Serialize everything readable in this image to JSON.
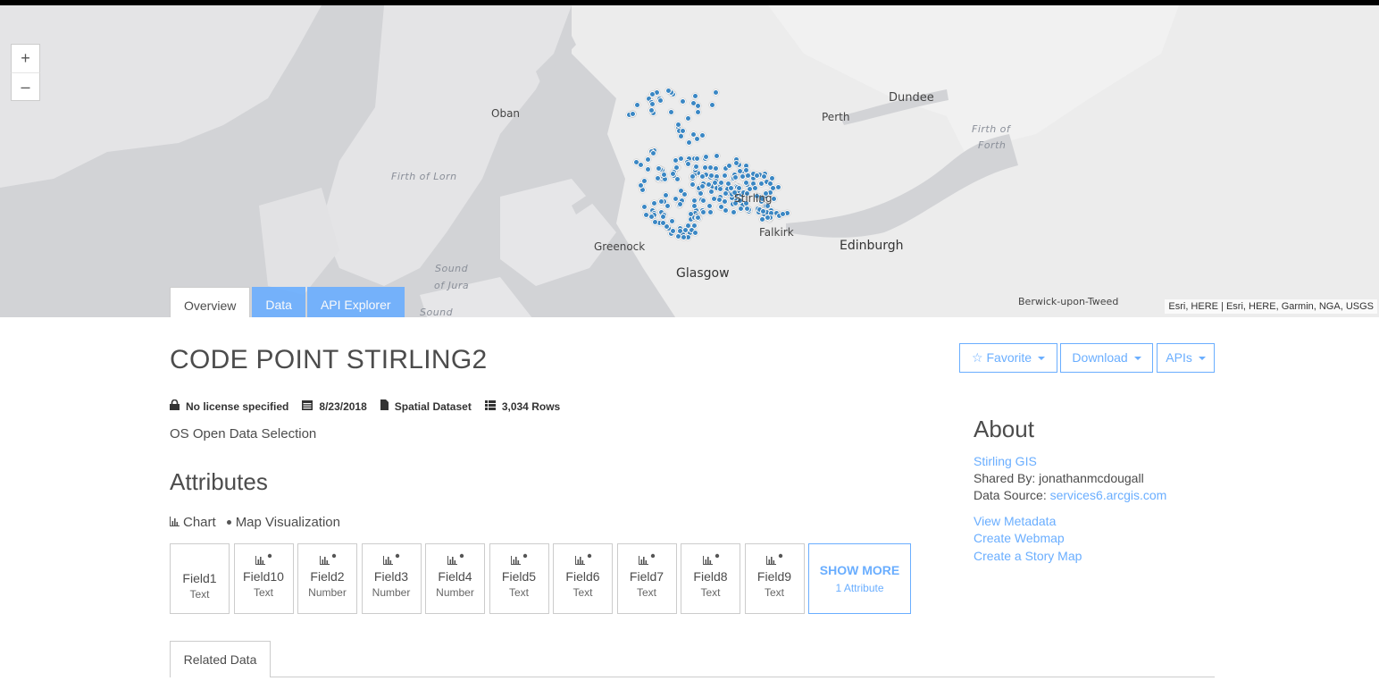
{
  "map": {
    "labels": {
      "dundee": "Dundee",
      "oban": "Oban",
      "perth": "Perth",
      "firth_of": "Firth of",
      "forth": "Forth",
      "firth_of_lorn": "Firth of Lorn",
      "stirling": "Stirling",
      "greenock": "Greenock",
      "falkirk": "Falkirk",
      "edinburgh": "Edinburgh",
      "glasgow": "Glasgow",
      "sound": "Sound",
      "of_jura": "of Jura",
      "sound2": "Sound",
      "berwick": "Berwick-upon-Tweed"
    },
    "attribution": "Esri, HERE | Esri, HERE, Garmin, NGA, USGS",
    "zoom_in": "+",
    "zoom_out": "–",
    "point_color": "#3a87c4"
  },
  "tabs": {
    "overview": "Overview",
    "data": "Data",
    "api_explorer": "API Explorer"
  },
  "dataset": {
    "title": "CODE POINT STIRLING2",
    "license": "No license specified",
    "date": "8/23/2018",
    "type": "Spatial Dataset",
    "rows": "3,034 Rows",
    "description": "OS Open Data Selection"
  },
  "attributes": {
    "heading": "Attributes",
    "legend_chart": "Chart",
    "legend_map": "Map Visualization",
    "fields": [
      {
        "name": "Field1",
        "type": "Text",
        "icons": false
      },
      {
        "name": "Field10",
        "type": "Text",
        "icons": true
      },
      {
        "name": "Field2",
        "type": "Number",
        "icons": true
      },
      {
        "name": "Field3",
        "type": "Number",
        "icons": true
      },
      {
        "name": "Field4",
        "type": "Number",
        "icons": true
      },
      {
        "name": "Field5",
        "type": "Text",
        "icons": true
      },
      {
        "name": "Field6",
        "type": "Text",
        "icons": true
      },
      {
        "name": "Field7",
        "type": "Text",
        "icons": true
      },
      {
        "name": "Field8",
        "type": "Text",
        "icons": true
      },
      {
        "name": "Field9",
        "type": "Text",
        "icons": true
      }
    ],
    "show_more": "SHOW MORE",
    "show_more_sub": "1 Attribute"
  },
  "related": {
    "tab": "Related Data"
  },
  "buttons": {
    "favorite": "Favorite",
    "download": "Download",
    "apis": "APIs"
  },
  "about": {
    "heading": "About",
    "org": "Stirling GIS",
    "shared_by_label": "Shared By: jonathanmcdougall",
    "data_source_label": "Data Source: ",
    "data_source_link": "services6.arcgis.com",
    "view_metadata": "View Metadata",
    "create_webmap": "Create Webmap",
    "create_story_map": "Create a Story Map"
  },
  "colors": {
    "accent": "#6aaeff",
    "map_water": "#d2d3d6",
    "map_land": "#ececec"
  }
}
